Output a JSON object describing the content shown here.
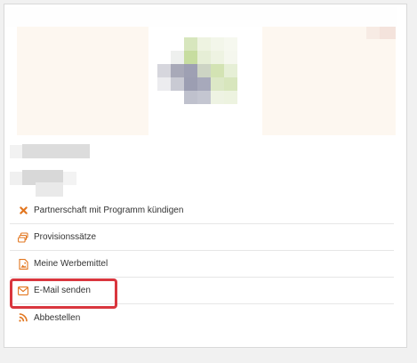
{
  "menu": {
    "items": [
      {
        "icon": "close-icon",
        "label": "Partnerschaft mit Programm kündigen"
      },
      {
        "icon": "stack-icon",
        "label": "Provisionssätze"
      },
      {
        "icon": "image-icon",
        "label": "Meine Werbemittel"
      },
      {
        "icon": "envelope-icon",
        "label": "E-Mail senden"
      },
      {
        "icon": "rss-icon",
        "label": "Abbestellen"
      }
    ]
  },
  "colors": {
    "accent": "#e2761f",
    "highlight": "#d9363e",
    "card_border": "#d9d9d9",
    "page_background": "#f1f1f1"
  }
}
